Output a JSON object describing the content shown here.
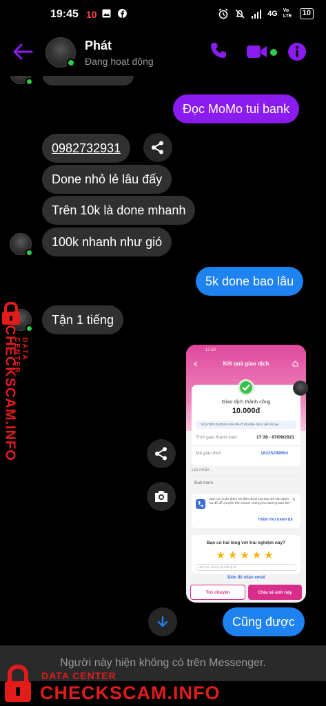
{
  "status_bar": {
    "time": "19:45",
    "notif_count": "10",
    "network": "4G",
    "volte": "Vo LTE",
    "battery": "10"
  },
  "header": {
    "name": "Phát",
    "status": "Đang hoạt động"
  },
  "messages": {
    "m1": "Đọc MoMo tui bank",
    "m2": "0982732931",
    "m3": "Done nhỏ lẻ lâu đấy",
    "m4": "Trên 10k là done mhanh",
    "m5": "100k nhanh như gió",
    "m6": "5k done bao lâu",
    "m7": "Tận 1 tiếng",
    "m8": "Cũng được"
  },
  "screenshot": {
    "status_time": "17:10",
    "title": "Kết quả giao dịch",
    "result": "Giao dịch thành công",
    "amount": "10.000đ",
    "notice": "NGUYEN DUONG ANH PHAT đã nhận được tiền từ bạn",
    "time_label": "Thời gian thanh toán",
    "time_value": "17:39 - 07/09/2021",
    "code_label": "Mã giao dịch",
    "code_value": "18325299654",
    "message_label": "Lời nhắn",
    "message_value": "Bull mem",
    "contact_prompt": "Bạn có muốn thêm số điện thoại của bạn bè vào danh bạ để dễ chuyển tiền nhanh chóng cho đường Bạn bè?",
    "contact_link": "THÊM VÀO DANH BẠ",
    "rating_question": "Bạn có hài lòng với trải nghiệm này?",
    "stars": "★★★★★",
    "feedback_placeholder": "Hãy cho chúng tôi biết lý do",
    "email_link": "Bấm để nhận email",
    "btn_chat": "Trò chuyện",
    "btn_share": "Chia sẻ ảnh này"
  },
  "bottom": {
    "notice": "Người này hiện không có trên Messenger."
  },
  "watermark": {
    "label": "DATA CENTER",
    "brand": "CHECKSCAM.INFO"
  },
  "colors": {
    "accent": "#8b1cf0",
    "outgoing_blue": "#1e82f0",
    "incoming": "#303030",
    "online": "#31cc46",
    "watermark": "#e21b1b"
  }
}
